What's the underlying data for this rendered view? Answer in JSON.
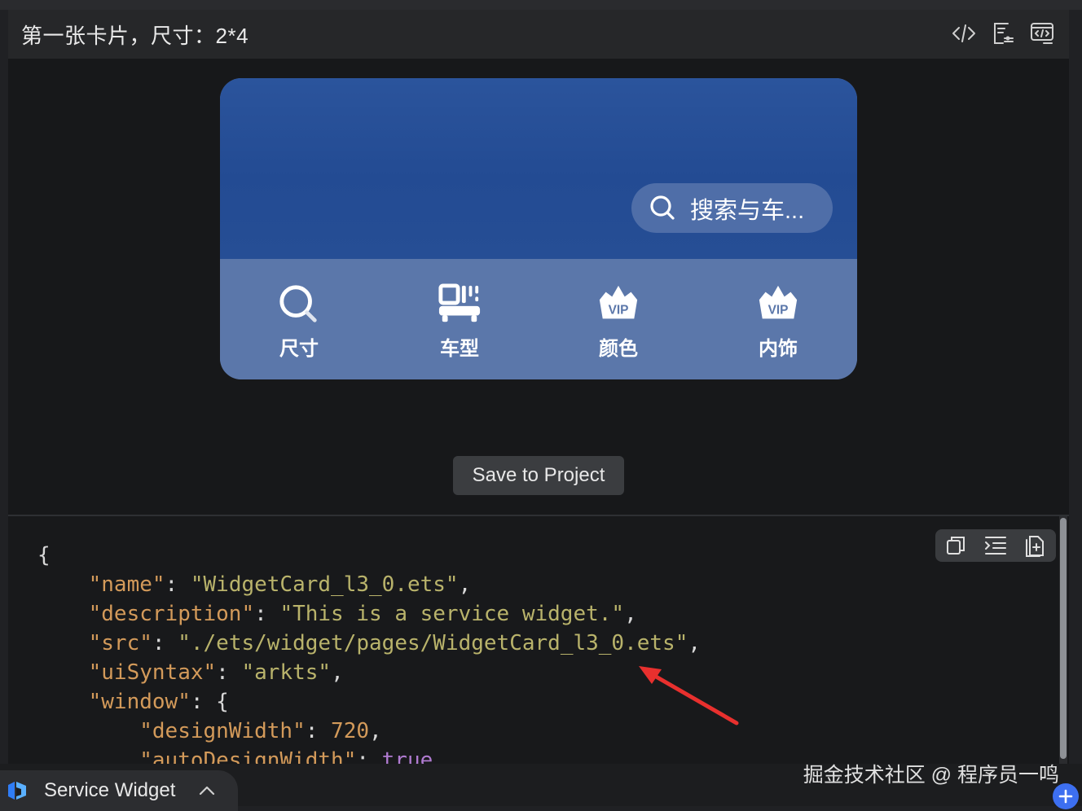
{
  "header": {
    "title": "第一张卡片，尺寸：2*4",
    "actions": [
      {
        "icon": "code-icon"
      },
      {
        "icon": "properties-icon"
      },
      {
        "icon": "code-preview-icon"
      }
    ]
  },
  "card": {
    "search_placeholder": "搜索与车...",
    "features": [
      {
        "label": "尺寸",
        "icon": "search-icon"
      },
      {
        "label": "车型",
        "icon": "car-model-icon"
      },
      {
        "label": "颜色",
        "icon": "vip-crown-icon"
      },
      {
        "label": "内饰",
        "icon": "vip-crown-icon"
      }
    ],
    "colors": {
      "top": "#234b93",
      "bottom": "#5b77aa",
      "pill": "#4f6ea8"
    }
  },
  "save_button": "Save to Project",
  "code": {
    "l1": "{",
    "l2_key": "\"name\"",
    "l2_val": "\"WidgetCard_l3_0.ets\"",
    "l3_key": "\"description\"",
    "l3_val": "\"This is a service widget.\"",
    "l4_key": "\"src\"",
    "l4_val": "\"./ets/widget/pages/WidgetCard_l3_0.ets\"",
    "l5_key": "\"uiSyntax\"",
    "l5_val": "\"arkts\"",
    "l6_key": "\"window\"",
    "l6_rest": "{",
    "l7_key": "\"designWidth\"",
    "l7_val": "720",
    "l8_key": "\"autoDesignWidth\"",
    "l8_val": "true",
    "toolbar": [
      "copy-icon",
      "format-icon",
      "insert-file-icon"
    ]
  },
  "bottom": {
    "tab_label": "Service Widget",
    "watermark": "掘金技术社区 @ 程序员一鸣"
  }
}
